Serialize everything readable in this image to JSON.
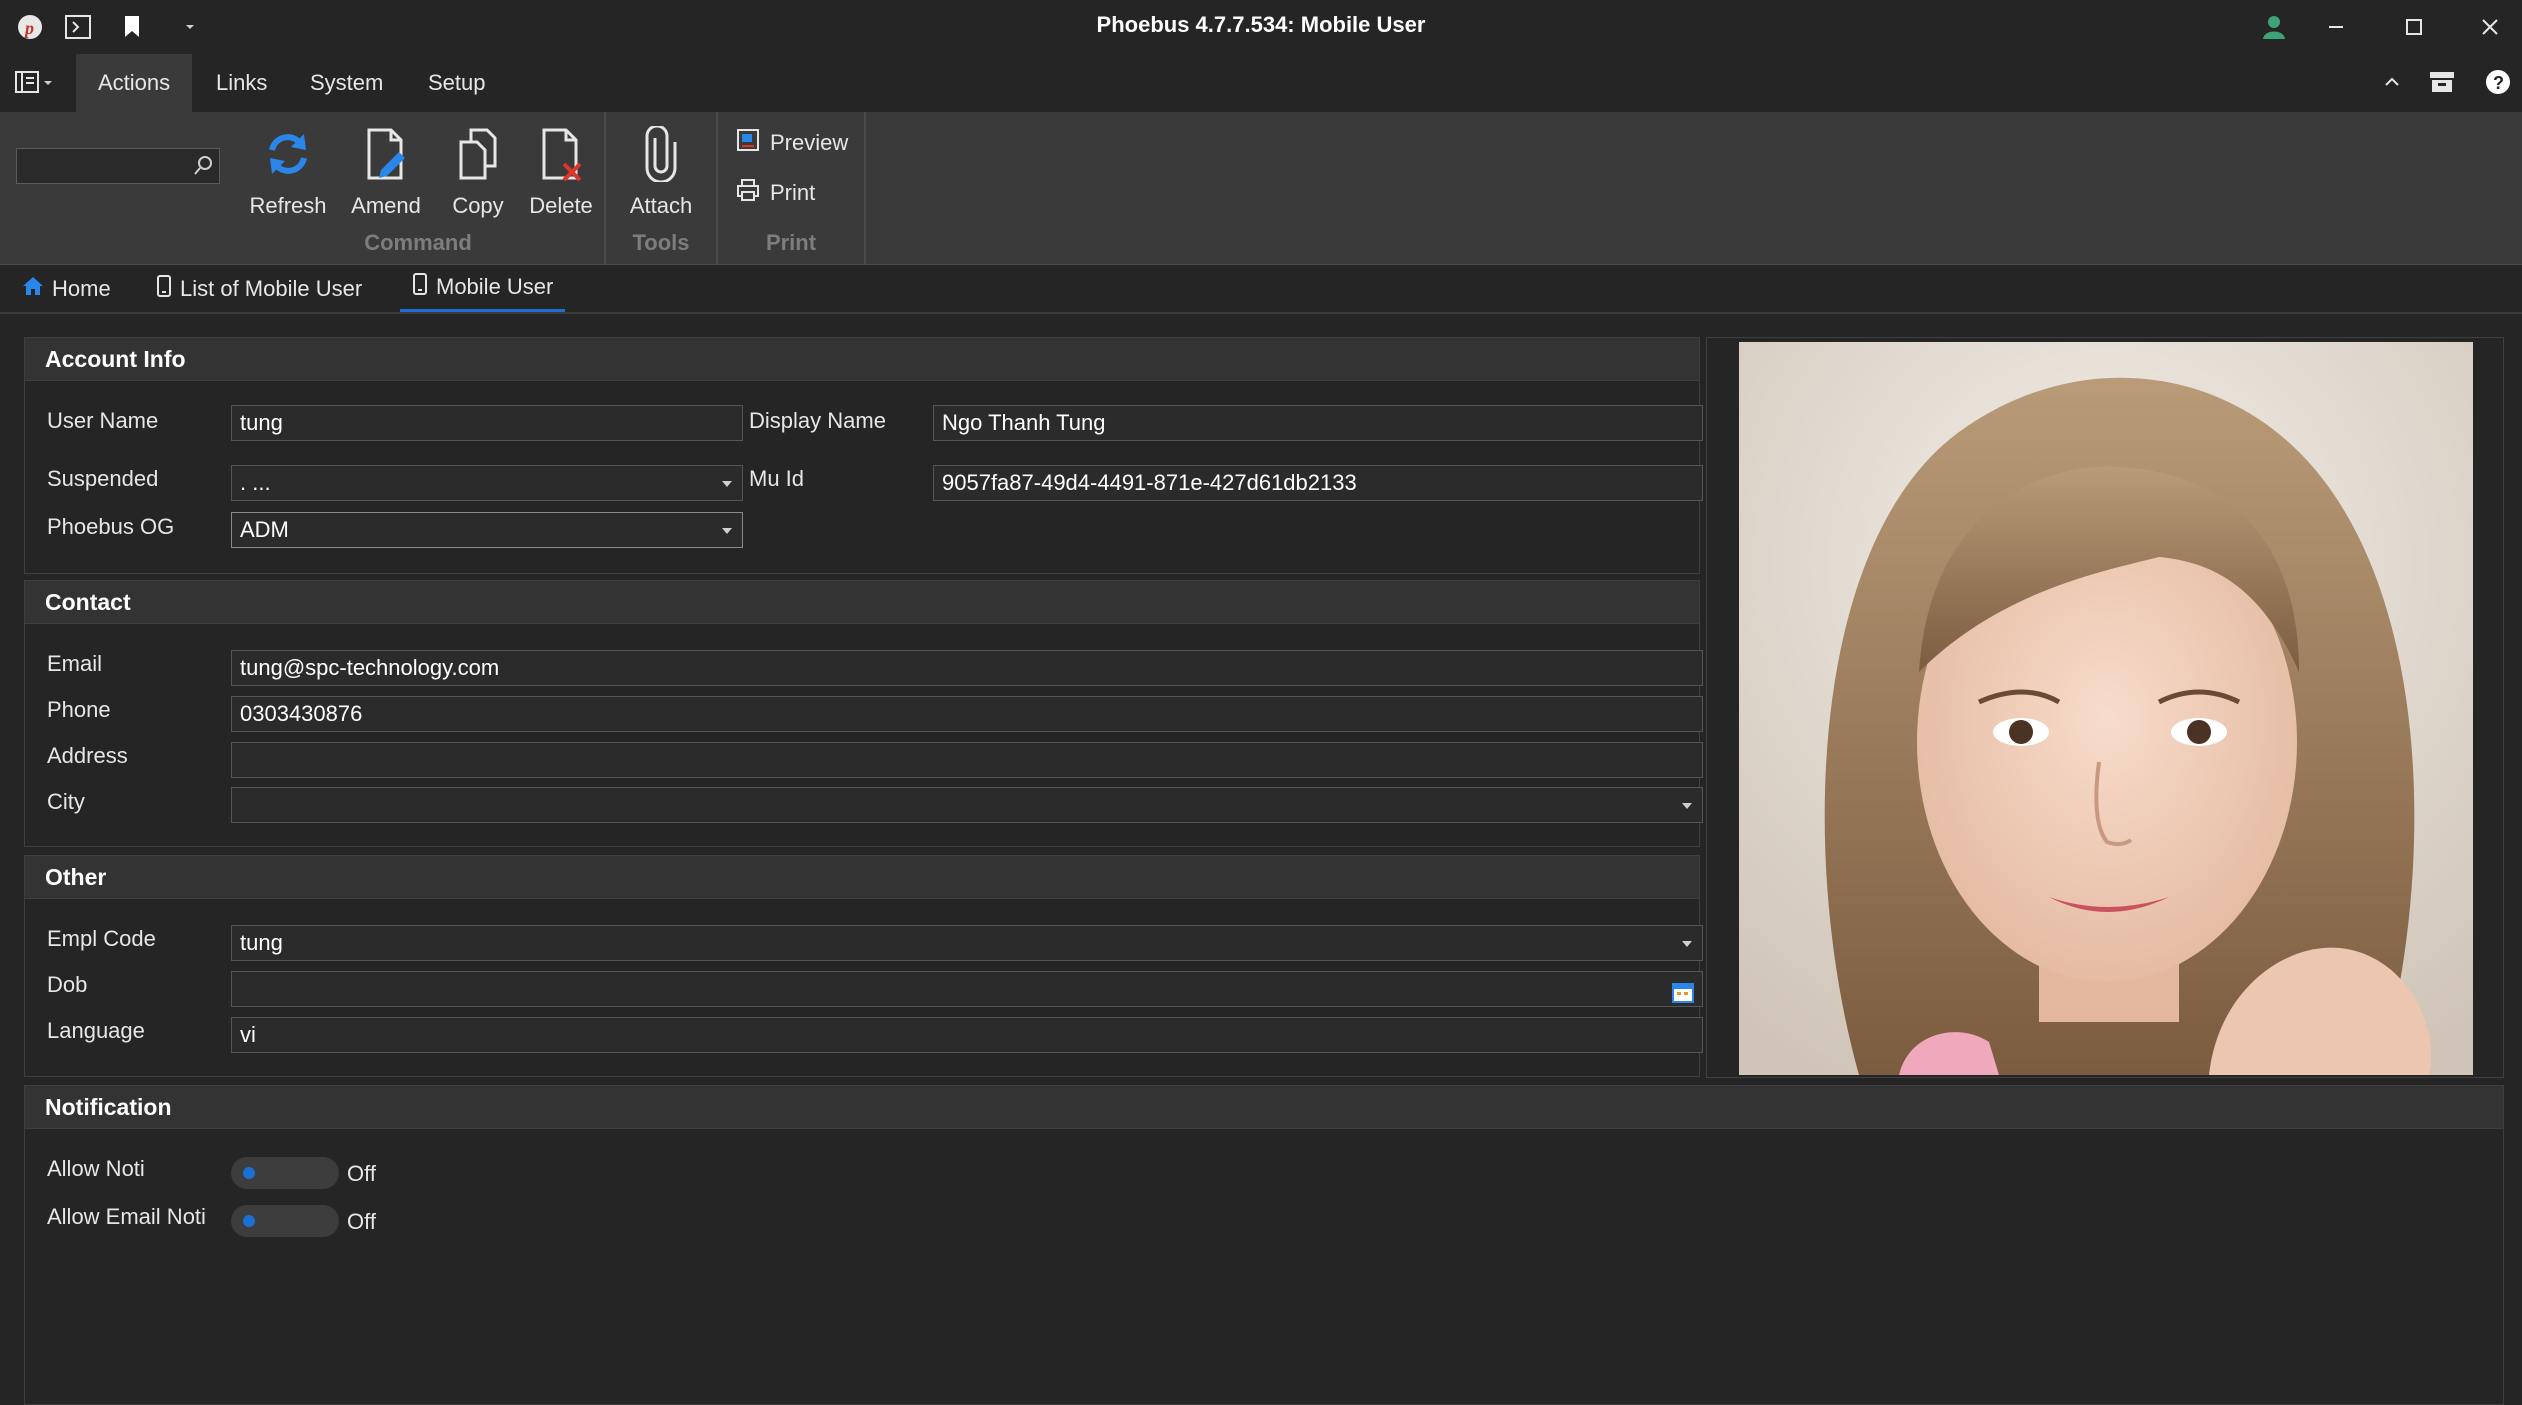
{
  "window": {
    "title": "Phoebus 4.7.7.534: Mobile User",
    "logo_icon": "phoebus-logo-icon",
    "quick_access": [
      "terminal-icon",
      "bookmark-icon",
      "dropdown-arrow-icon"
    ],
    "controls": [
      "user-icon",
      "minimize-icon",
      "maximize-icon",
      "close-icon"
    ]
  },
  "menu": {
    "items": [
      "Actions",
      "Links",
      "System",
      "Setup"
    ],
    "active": "Actions"
  },
  "ribbon": {
    "search_value": "",
    "groups": {
      "command": {
        "label": "Command",
        "buttons": [
          {
            "label": "Refresh",
            "icon": "refresh-icon"
          },
          {
            "label": "Amend",
            "icon": "edit-icon"
          },
          {
            "label": "Copy",
            "icon": "copy-icon"
          },
          {
            "label": "Delete",
            "icon": "delete-icon"
          }
        ]
      },
      "tools": {
        "label": "Tools",
        "buttons": [
          {
            "label": "Attach",
            "icon": "paperclip-icon"
          }
        ]
      },
      "print": {
        "label": "Print",
        "buttons": [
          {
            "label": "Preview",
            "icon": "preview-icon"
          },
          {
            "label": "Print",
            "icon": "printer-icon"
          }
        ]
      }
    }
  },
  "tabs": [
    {
      "label": "Home",
      "icon": "home-icon"
    },
    {
      "label": "List of Mobile User",
      "icon": "mobile-icon"
    },
    {
      "label": "Mobile User",
      "icon": "mobile-icon",
      "active": true
    }
  ],
  "account_info": {
    "title": "Account Info",
    "user_name": {
      "label": "User Name",
      "value": "tung"
    },
    "display_name": {
      "label": "Display Name",
      "value": "Ngo Thanh Tung"
    },
    "suspended": {
      "label": "Suspended",
      "value": ". ..."
    },
    "mu_id": {
      "label": "Mu Id",
      "value": "9057fa87-49d4-4491-871e-427d61db2133"
    },
    "phoebus_og": {
      "label": "Phoebus OG",
      "value": "ADM"
    }
  },
  "contact": {
    "title": "Contact",
    "email": {
      "label": "Email",
      "value": "tung@spc-technology.com"
    },
    "phone": {
      "label": "Phone",
      "value": "0303430876"
    },
    "address": {
      "label": "Address",
      "value": ""
    },
    "city": {
      "label": "City",
      "value": ""
    }
  },
  "other": {
    "title": "Other",
    "empl_code": {
      "label": "Empl Code",
      "value": "tung"
    },
    "dob": {
      "label": "Dob",
      "value": "",
      "icon": "calendar-icon"
    },
    "language": {
      "label": "Language",
      "value": "vi"
    }
  },
  "notification": {
    "title": "Notification",
    "allow_noti": {
      "label": "Allow Noti",
      "state": "Off"
    },
    "allow_email_noti": {
      "label": "Allow Email Noti",
      "state": "Off"
    }
  },
  "colors": {
    "accent": "#1c6fd3",
    "background": "#252525",
    "ribbon": "#3a3a3a",
    "delete_red": "#e0352b"
  }
}
